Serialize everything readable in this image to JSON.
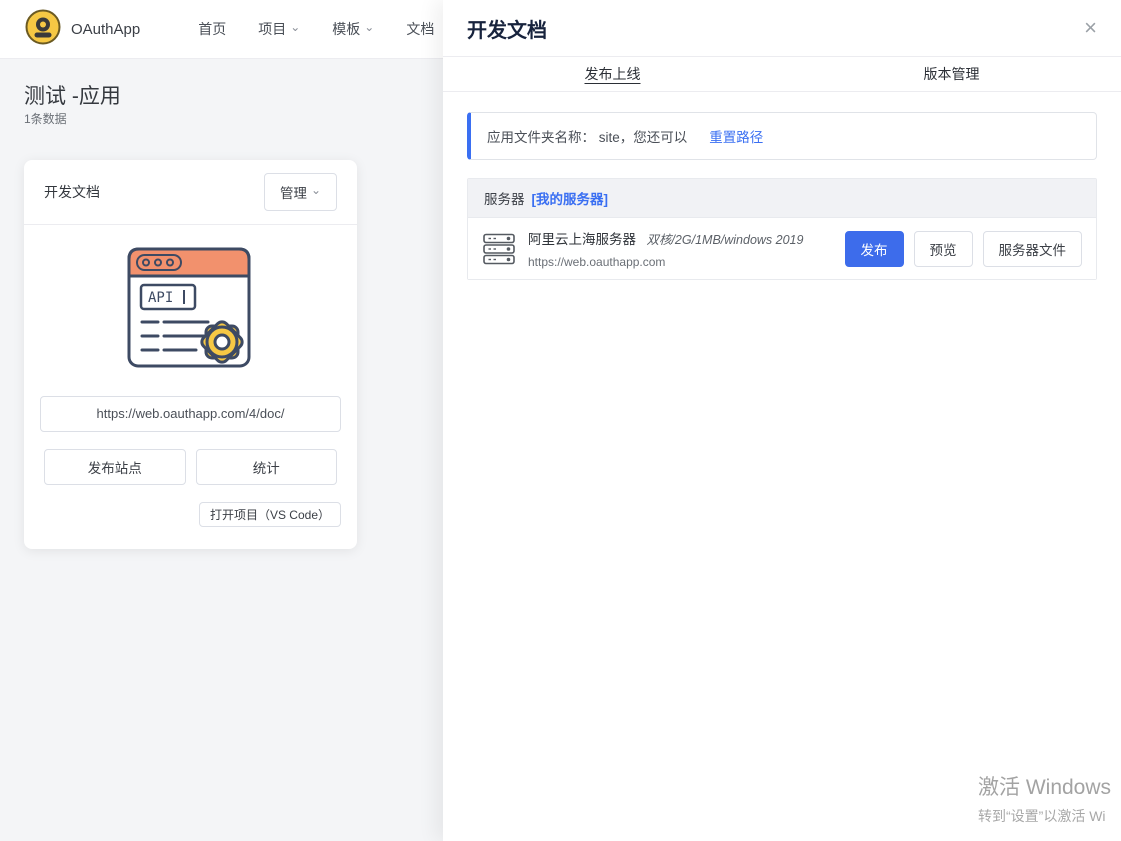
{
  "navbar": {
    "brand": "OAuthApp",
    "items": [
      {
        "label": "首页",
        "dropdown": false
      },
      {
        "label": "项目",
        "dropdown": true
      },
      {
        "label": "模板",
        "dropdown": true
      },
      {
        "label": "文档",
        "dropdown": false
      }
    ]
  },
  "page": {
    "title": "测试 -应用",
    "subtitle": "1条数据"
  },
  "card": {
    "title": "开发文档",
    "manage_button": "管理",
    "illustration_text": "API",
    "url": "https://web.oauthapp.com/4/doc/",
    "publish_site_button": "发布站点",
    "stats_button": "统计",
    "open_project_button": "打开项目（VS Code）"
  },
  "drawer": {
    "title": "开发文档",
    "tabs": [
      {
        "label": "发布上线",
        "active": true
      },
      {
        "label": "版本管理",
        "active": false
      }
    ],
    "alert": {
      "text": "应用文件夹名称： site，您还可以",
      "link": "重置路径"
    },
    "server_section": {
      "label": "服务器",
      "link": "[我的服务器]",
      "server": {
        "name": "阿里云上海服务器",
        "spec": "双核/2G/1MB/windows 2019",
        "url": "https://web.oauthapp.com",
        "publish_button": "发布",
        "preview_button": "预览",
        "files_button": "服务器文件"
      }
    }
  },
  "watermark": {
    "line1": "激活 Windows",
    "line2": "转到“设置”以激活 Wi"
  },
  "icons": {
    "close": "×",
    "chevron_down": "⌄"
  },
  "colors": {
    "accent_blue": "#3d6ceb",
    "link_blue": "#3a6ff2",
    "logo_yellow": "#f6c844",
    "illustration_orange": "#f2916d",
    "page_background": "#f4f5f7"
  }
}
